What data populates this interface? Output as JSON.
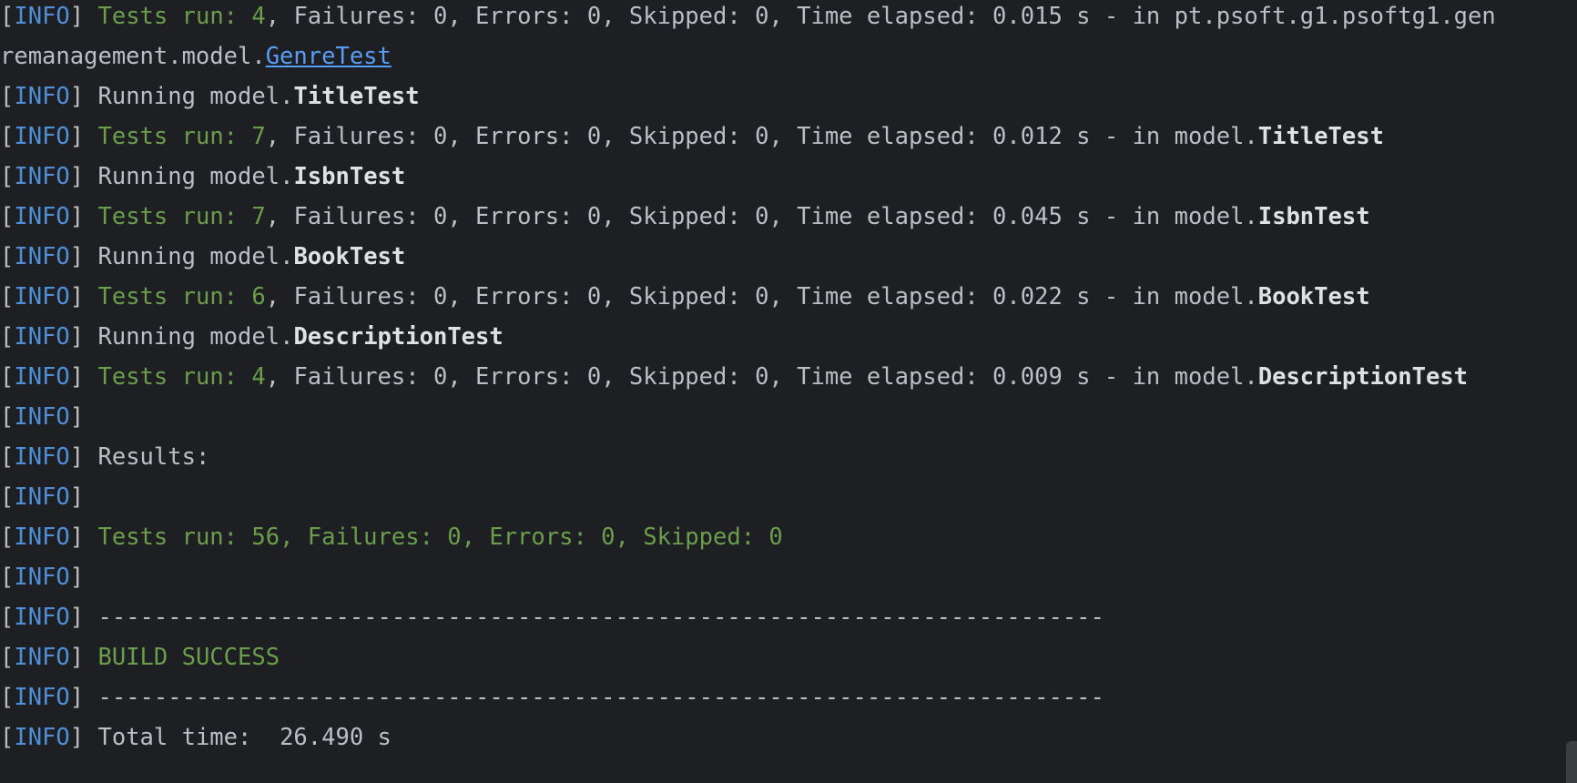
{
  "console": {
    "tag_open": "[",
    "tag_close": "]",
    "tag": "INFO",
    "line1": {
      "tests_run": "Tests run: 4",
      "rest": ", Failures: 0, Errors: 0, Skipped: 0, Time elapsed: 0.015 s - in pt.psoft.g1.psoftg1.gen"
    },
    "line2": {
      "prefix": "remanagement.model.",
      "link": "GenreTest"
    },
    "line3": {
      "prefix": " Running model.",
      "class": "TitleTest"
    },
    "line4": {
      "tests_run": "Tests run: 7",
      "rest": ", Failures: 0, Errors: 0, Skipped: 0, Time elapsed: 0.012 s - in model.",
      "class": "TitleTest"
    },
    "line5": {
      "prefix": " Running model.",
      "class": "IsbnTest"
    },
    "line6": {
      "tests_run": "Tests run: 7",
      "rest": ", Failures: 0, Errors: 0, Skipped: 0, Time elapsed: 0.045 s - in model.",
      "class": "IsbnTest"
    },
    "line7": {
      "prefix": " Running model.",
      "class": "BookTest"
    },
    "line8": {
      "tests_run": "Tests run: 6",
      "rest": ", Failures: 0, Errors: 0, Skipped: 0, Time elapsed: 0.022 s - in model.",
      "class": "BookTest"
    },
    "line9": {
      "prefix": " Running model.",
      "class": "DescriptionTest"
    },
    "line10": {
      "tests_run": "Tests run: 4",
      "rest": ", Failures: 0, Errors: 0, Skipped: 0, Time elapsed: 0.009 s - in model.",
      "class": "DescriptionTest"
    },
    "results_label": " Results:",
    "summary": " Tests run: 56, Failures: 0, Errors: 0, Skipped: 0",
    "separator": " ------------------------------------------------------------------------",
    "build_status": " BUILD SUCCESS",
    "total_time": " Total time:  26.490 s"
  },
  "colors": {
    "background": "#1e1f22",
    "info_tag": "#4f8fd8",
    "success_green": "#6a9e4c",
    "text": "#bcbec4",
    "link": "#589df6"
  }
}
